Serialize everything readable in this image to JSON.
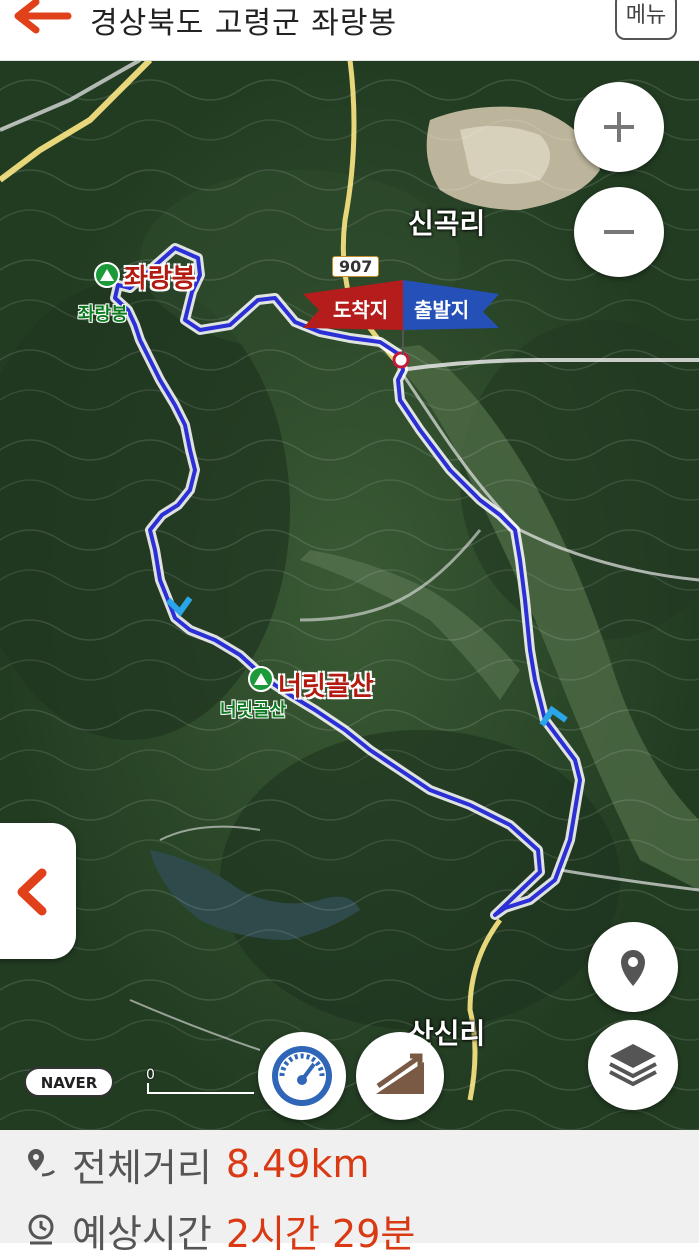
{
  "header": {
    "title": "경상북도 고령군 좌랑봉",
    "menu_label": "메뉴"
  },
  "map": {
    "places": {
      "singok": "신곡리",
      "sansin": "산신리"
    },
    "road_number": "907",
    "flags": {
      "arrival": "도착지",
      "departure": "출발지"
    },
    "peaks": [
      {
        "name": "좌랑봉",
        "sub": "좌랑봉"
      },
      {
        "name": "너릿골산",
        "sub": "너릿골산"
      }
    ],
    "zoom_in": "+",
    "zoom_out": "−",
    "logo": "NAVER",
    "scale_label": "0"
  },
  "info": {
    "distance_label": "전체거리",
    "distance_value": "8.49km",
    "time_label": "예상시간",
    "time_value": "2시간 29분"
  },
  "colors": {
    "accent": "#d93a14",
    "route": "#2b2fd6",
    "forest": "#2b4a2c"
  },
  "icons": [
    "back-arrow-icon",
    "plus-icon",
    "minus-icon",
    "location-pin-icon",
    "layers-icon",
    "speedometer-icon",
    "slope-icon",
    "chevron-left-icon",
    "route-distance-icon",
    "clock-icon"
  ]
}
